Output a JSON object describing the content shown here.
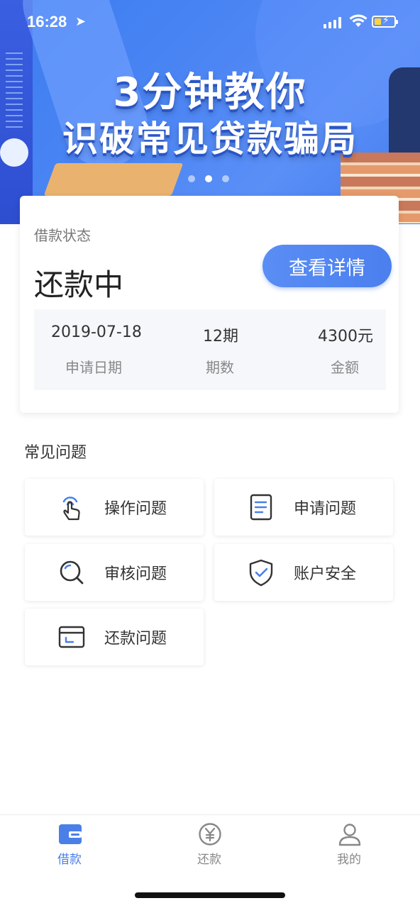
{
  "status_bar": {
    "time": "16:28"
  },
  "banner": {
    "line1": "3分钟教你",
    "line2": "识破常见贷款骗局",
    "dots": 3,
    "active_dot": 2
  },
  "loan_card": {
    "label": "借款状态",
    "state": "还款中",
    "detail_button": "查看详情",
    "date_value": "2019-07-18",
    "date_caption": "申请日期",
    "periods_value": "12期",
    "periods_caption": "期数",
    "amount_value": "4300元",
    "amount_caption": "金额"
  },
  "faq": {
    "title": "常见问题",
    "items": [
      {
        "label": "操作问题",
        "icon": "tap-hand-icon"
      },
      {
        "label": "申请问题",
        "icon": "document-icon"
      },
      {
        "label": "审核问题",
        "icon": "magnifier-icon"
      },
      {
        "label": "账户安全",
        "icon": "shield-check-icon"
      },
      {
        "label": "还款问题",
        "icon": "card-icon"
      }
    ]
  },
  "tabs": [
    {
      "label": "借款",
      "icon": "wallet-icon",
      "active": true
    },
    {
      "label": "还款",
      "icon": "yen-coin-icon",
      "active": false
    },
    {
      "label": "我的",
      "icon": "person-icon",
      "active": false
    }
  ],
  "colors": {
    "accent": "#4a7fe8",
    "banner": "#4d86f4"
  }
}
